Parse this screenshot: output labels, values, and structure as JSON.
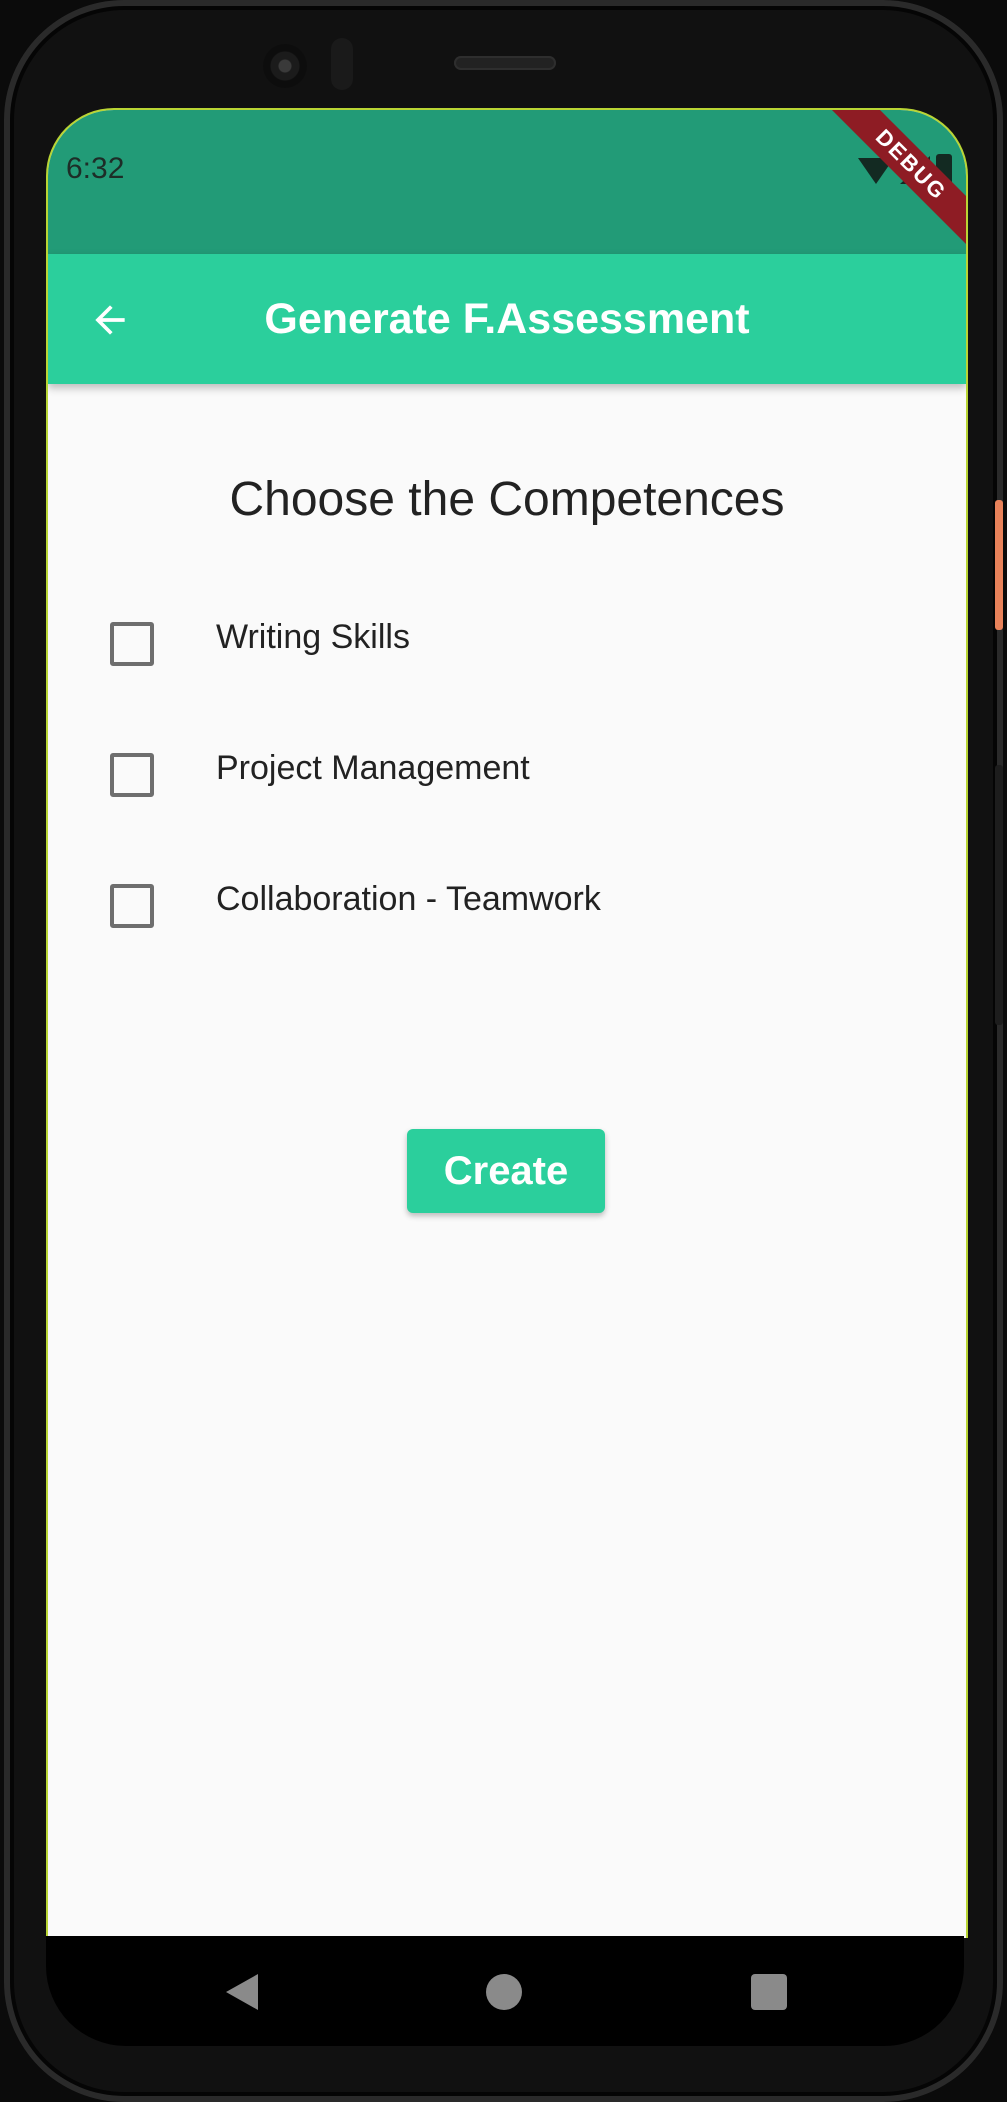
{
  "status_bar": {
    "time": "6:32",
    "debug_label": "DEBUG"
  },
  "app_bar": {
    "title": "Generate F.Assessment",
    "back_icon": "arrow-left-icon"
  },
  "main": {
    "heading": "Choose the Competences",
    "competences": [
      {
        "label": "Writing Skills",
        "checked": false
      },
      {
        "label": "Project Management",
        "checked": false
      },
      {
        "label": "Collaboration - Teamwork",
        "checked": false
      }
    ],
    "create_label": "Create"
  },
  "colors": {
    "status_bar": "#229b77",
    "app_bar": "#2bcf9c",
    "accent": "#2bcf9c",
    "debug_banner": "#8e1c24",
    "background": "#fafafa"
  }
}
